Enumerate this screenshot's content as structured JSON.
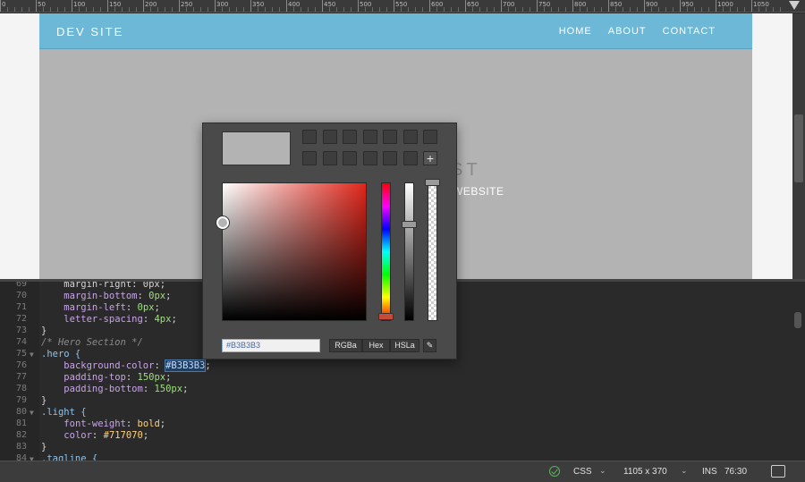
{
  "ruler": {
    "labels": [
      "0",
      "50",
      "100",
      "150",
      "200",
      "250",
      "300",
      "350",
      "400",
      "450",
      "500",
      "550",
      "600",
      "650",
      "700",
      "750",
      "800",
      "850",
      "900",
      "950",
      "1000",
      "1050"
    ]
  },
  "site": {
    "brand": "DEV SITE",
    "nav": [
      "HOME",
      "ABOUT",
      "CONTACT"
    ],
    "hero_title_visible": "ST",
    "hero_tagline_visible": "WEBSITE"
  },
  "code": {
    "lines": [
      {
        "num": "69",
        "text": "    margin-right: 0px;"
      },
      {
        "num": "70",
        "prop": "margin-bottom",
        "value": "0px"
      },
      {
        "num": "71",
        "prop": "margin-left",
        "value": "0px"
      },
      {
        "num": "72",
        "prop": "letter-spacing",
        "value": "4px"
      },
      {
        "num": "73",
        "text": "}"
      },
      {
        "num": "74",
        "comment": "/* Hero Section */"
      },
      {
        "num": "75",
        "selector": ".hero {",
        "fold": "▼"
      },
      {
        "num": "76",
        "prop": "background-color",
        "value": "#B3B3B3"
      },
      {
        "num": "77",
        "prop": "padding-top",
        "value": "150px"
      },
      {
        "num": "78",
        "prop": "padding-bottom",
        "value": "150px"
      },
      {
        "num": "79",
        "text": "}"
      },
      {
        "num": "80",
        "selector": ".light {",
        "fold": "▼"
      },
      {
        "num": "81",
        "prop": "font-weight",
        "value": "bold"
      },
      {
        "num": "82",
        "prop": "color",
        "value": "#717070"
      },
      {
        "num": "83",
        "text": "}"
      },
      {
        "num": "84",
        "selector": ".tagline {",
        "fold": "▼"
      }
    ]
  },
  "status": {
    "language": "CSS",
    "dimensions": "1105 x 370",
    "mode": "INS",
    "position": "76:30"
  },
  "picker": {
    "current_color": "#B3B3B3",
    "hex_value": "#B3B3B3",
    "modes": [
      "RGBa",
      "Hex",
      "HSLa"
    ],
    "eyedropper_icon": "eyedropper-icon",
    "add_swatch_label": "+",
    "accent": "#e0261a",
    "hue": 0.97,
    "brightness": 0.7,
    "alpha": 1.0
  },
  "colors": {
    "navbar": "#6cb8d6",
    "hero_bg": "#b3b3b3",
    "editor_bg": "#2a2a2a"
  }
}
